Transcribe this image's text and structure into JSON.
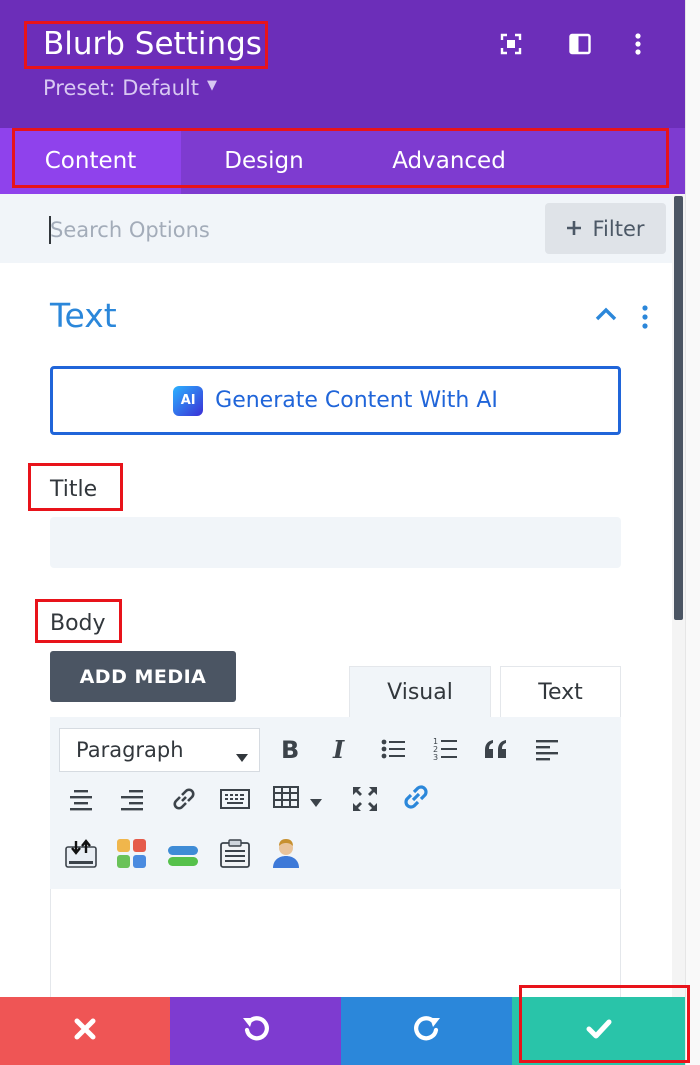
{
  "header": {
    "title": "Blurb Settings",
    "preset_label": "Preset: Default",
    "icons": [
      "fullscreen-icon",
      "split-view-icon",
      "more-options-icon"
    ],
    "background_color": "#6c2eb9"
  },
  "tabs": [
    {
      "label": "Content",
      "active": true
    },
    {
      "label": "Design",
      "active": false
    },
    {
      "label": "Advanced",
      "active": false
    }
  ],
  "search": {
    "placeholder": "Search Options",
    "value": "",
    "filter_label": "Filter"
  },
  "section": {
    "title": "Text",
    "expanded": true,
    "ai_button_label": "Generate Content With AI",
    "ai_badge": "AI"
  },
  "fields": {
    "title_label": "Title",
    "title_value": "",
    "body_label": "Body"
  },
  "editor": {
    "add_media_label": "ADD MEDIA",
    "mode_tabs": [
      "Visual",
      "Text"
    ],
    "active_mode": "Visual",
    "format_value": "Paragraph",
    "toolbar_icons": [
      "bold-icon",
      "italic-icon",
      "bullet-list-icon",
      "numbered-list-icon",
      "blockquote-icon",
      "align-left-icon",
      "align-center-icon",
      "align-right-icon",
      "link-icon",
      "keyboard-icon",
      "table-icon",
      "fullscreen-icon",
      "link-blue-icon",
      "import-icon",
      "colored-grid-icon",
      "colored-bars-icon",
      "clipboard-icon",
      "user-icon"
    ]
  },
  "bottom_bar": [
    {
      "name": "cancel",
      "icon": "close-icon",
      "color": "#ef5555"
    },
    {
      "name": "undo",
      "icon": "undo-icon",
      "color": "#7e3bd0"
    },
    {
      "name": "redo",
      "icon": "redo-icon",
      "color": "#2b87da"
    },
    {
      "name": "save",
      "icon": "checkmark-icon",
      "color": "#29c4a9"
    }
  ],
  "colors": {
    "accent_blue": "#2b87da",
    "highlight_red": "#e8131a",
    "tab_bar": "#7e3bd0",
    "active_tab": "#8f42ec"
  }
}
